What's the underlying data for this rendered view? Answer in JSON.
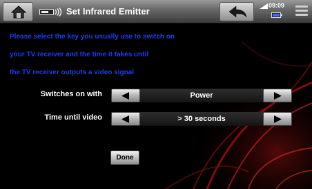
{
  "header": {
    "title": "Set Infrared Emitter",
    "clock": "09:09",
    "home_icon": "home-icon",
    "back_icon": "back-arrow-icon",
    "menu_icon": "menu-icon"
  },
  "instructions": [
    "Please select the key you usually use to switch on",
    "your TV receiver and the time it takes until",
    "the TV receiver outputs a video signal"
  ],
  "settings": [
    {
      "label": "Switches on with",
      "value": "Power"
    },
    {
      "label": "Time until video",
      "value": "> 30 seconds"
    }
  ],
  "done_label": "Done",
  "colors": {
    "instruction_text": "#1a3cff",
    "background": "#000000",
    "accent_red": "#b01010"
  }
}
